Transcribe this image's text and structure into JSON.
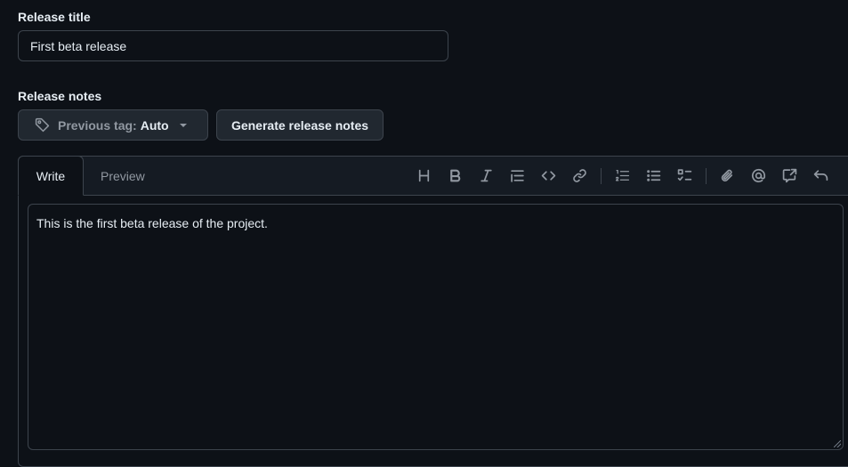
{
  "title_section": {
    "label": "Release title",
    "value": "First beta release"
  },
  "notes_section": {
    "label": "Release notes",
    "previous_tag_prefix": "Previous tag:",
    "previous_tag_value": "Auto",
    "generate_button": "Generate release notes"
  },
  "editor": {
    "tabs": [
      {
        "label": "Write",
        "active": true
      },
      {
        "label": "Preview",
        "active": false
      }
    ],
    "toolbar_icons": [
      "heading-icon",
      "bold-icon",
      "italic-icon",
      "quote-icon",
      "code-icon",
      "link-icon",
      "numbered-list-icon",
      "unordered-list-icon",
      "task-list-icon",
      "attach-icon",
      "mention-icon",
      "cross-reference-icon",
      "undo-icon"
    ],
    "content": "This is the first beta release of the project."
  }
}
